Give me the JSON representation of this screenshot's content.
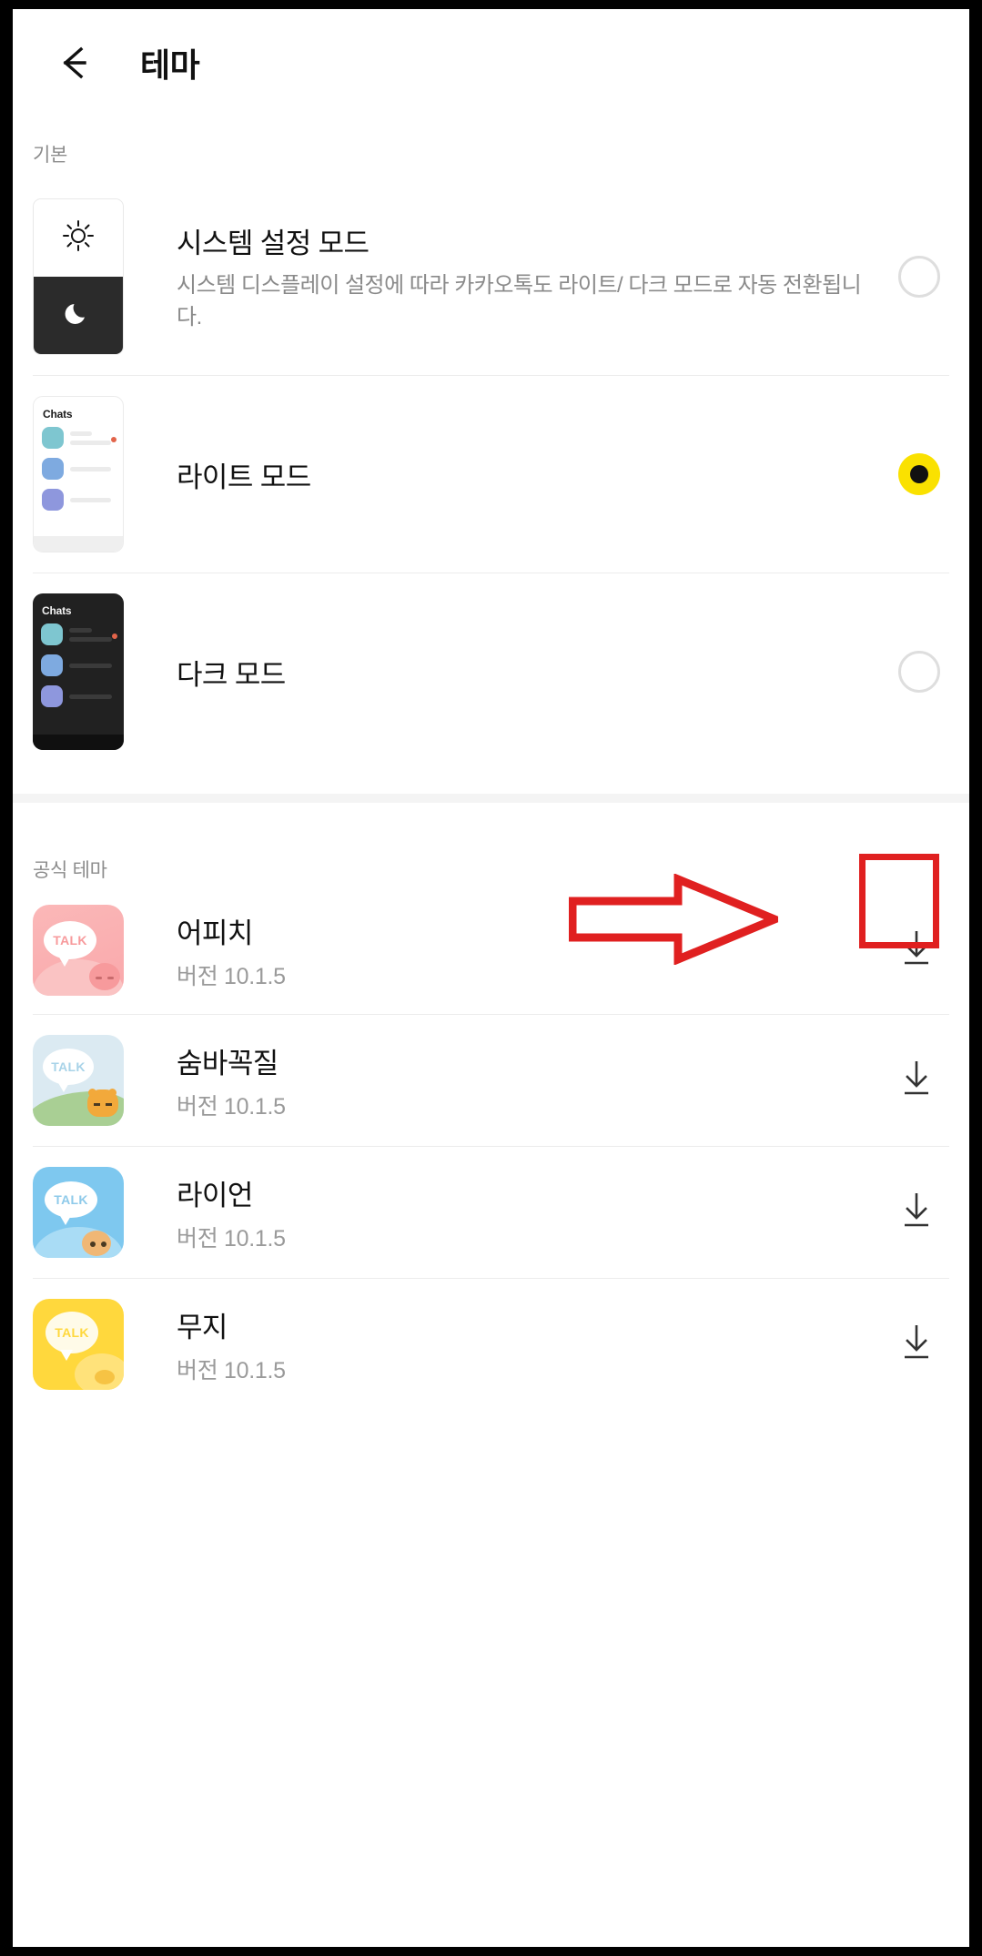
{
  "header": {
    "title": "테마",
    "back_icon": "arrow-left-icon"
  },
  "sections": {
    "basic_label": "기본",
    "official_label": "공식 테마"
  },
  "modes": [
    {
      "id": "system",
      "title": "시스템 설정 모드",
      "desc": "시스템 디스플레이 설정에 따라 카카오톡도 라이트/ 다크 모드로 자동 전환됩니다.",
      "selected": false,
      "thumb": "sun-moon-split-thumbnail"
    },
    {
      "id": "light",
      "title": "라이트 모드",
      "desc": "",
      "selected": true,
      "thumb": "light-phone-thumbnail",
      "thumb_label": "Chats"
    },
    {
      "id": "dark",
      "title": "다크 모드",
      "desc": "",
      "selected": false,
      "thumb": "dark-phone-thumbnail",
      "thumb_label": "Chats"
    }
  ],
  "themes": [
    {
      "name": "어피치",
      "version": "버전 10.1.5",
      "bubble_text": "TALK",
      "download_icon": "download-icon"
    },
    {
      "name": "숨바꼭질",
      "version": "버전 10.1.5",
      "bubble_text": "TALK",
      "download_icon": "download-icon"
    },
    {
      "name": "라이언",
      "version": "버전 10.1.5",
      "bubble_text": "TALK",
      "download_icon": "download-icon"
    },
    {
      "name": "무지",
      "version": "버전 10.1.5",
      "bubble_text": "TALK",
      "download_icon": "download-icon"
    }
  ],
  "annotation": {
    "arrow_icon": "red-right-arrow-annotation",
    "box_icon": "red-highlight-box-annotation",
    "color": "#e02020"
  },
  "colors": {
    "accent_yellow": "#FAE100",
    "radio_off_border": "#dedede",
    "text_primary": "#111111",
    "text_secondary": "#8a8a8a"
  }
}
